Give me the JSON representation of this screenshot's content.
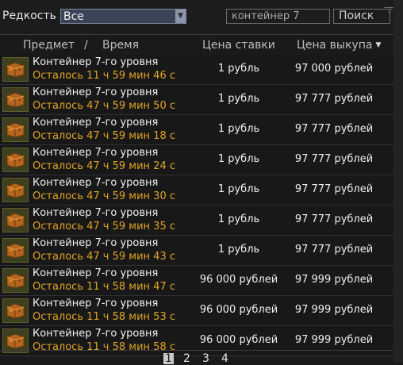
{
  "filter": {
    "rarity_label": "Редкость",
    "rarity_value": "Все",
    "search_value": "контейнер 7",
    "search_button": "Поиск"
  },
  "headers": {
    "item": "Предмет",
    "separator": "/",
    "time": "Время",
    "bid": "Цена ставки",
    "buyout": "Цена выкупа"
  },
  "lots": [
    {
      "name": "Контейнер 7-го уровня",
      "time": "Осталось 11 ч 59 мин 46 с",
      "bid": "1 рубль",
      "buyout": "97 000 рублей"
    },
    {
      "name": "Контейнер 7-го уровня",
      "time": "Осталось 47 ч 59 мин 50 с",
      "bid": "1 рубль",
      "buyout": "97 777 рублей"
    },
    {
      "name": "Контейнер 7-го уровня",
      "time": "Осталось 47 ч 59 мин 18 с",
      "bid": "1 рубль",
      "buyout": "97 777 рублей"
    },
    {
      "name": "Контейнер 7-го уровня",
      "time": "Осталось 47 ч 59 мин 24 с",
      "bid": "1 рубль",
      "buyout": "97 777 рублей"
    },
    {
      "name": "Контейнер 7-го уровня",
      "time": "Осталось 47 ч 59 мин 30 с",
      "bid": "1 рубль",
      "buyout": "97 777 рублей"
    },
    {
      "name": "Контейнер 7-го уровня",
      "time": "Осталось 47 ч 59 мин 35 с",
      "bid": "1 рубль",
      "buyout": "97 777 рублей"
    },
    {
      "name": "Контейнер 7-го уровня",
      "time": "Осталось 47 ч 59 мин 43 с",
      "bid": "1 рубль",
      "buyout": "97 777 рублей"
    },
    {
      "name": "Контейнер 7-го уровня",
      "time": "Осталось 11 ч 58 мин 47 с",
      "bid": "96 000 рублей",
      "buyout": "97 999 рублей"
    },
    {
      "name": "Контейнер 7-го уровня",
      "time": "Осталось 11 ч 58 мин 53 с",
      "bid": "96 000 рублей",
      "buyout": "97 999 рублей"
    },
    {
      "name": "Контейнер 7-го уровня",
      "time": "Осталось 11 ч 58 мин 58 с",
      "bid": "96 000 рублей",
      "buyout": "97 999 рублей"
    }
  ],
  "pagination": {
    "pages": [
      "1",
      "2",
      "3",
      "4"
    ],
    "current": "1"
  },
  "icons": {
    "dropdown": "chevron-down-icon",
    "sort": "sort-desc-icon",
    "item": "container-crate-icon"
  }
}
